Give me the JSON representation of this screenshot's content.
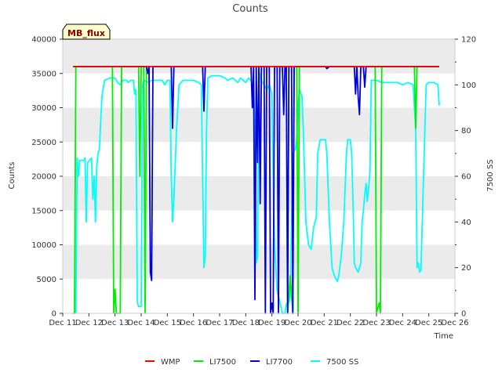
{
  "chart_data": {
    "type": "line",
    "title": "Counts",
    "xlabel": "Time",
    "ylabel": "Counts",
    "y2label": "7500 SS",
    "badge": "MB_flux",
    "x_ticks": [
      "Dec 11",
      "Dec 12",
      "Dec 13",
      "Dec 14",
      "Dec 15",
      "Dec 16",
      "Dec 17",
      "Dec 18",
      "Dec 19",
      "Dec 20",
      "Dec 21",
      "Dec 22",
      "Dec 23",
      "Dec 24",
      "Dec 25",
      "Dec 26"
    ],
    "xlim": [
      11,
      26
    ],
    "ylim": [
      0,
      40000
    ],
    "y_ticks": [
      0,
      5000,
      10000,
      15000,
      20000,
      25000,
      30000,
      35000,
      40000
    ],
    "y2lim": [
      0,
      120
    ],
    "y2_ticks": [
      0,
      20,
      40,
      60,
      80,
      100,
      120
    ],
    "grid": "horizontal bands",
    "legend_position": "bottom",
    "series": [
      {
        "name": "WMP",
        "axis": "left",
        "color": "#ff0000",
        "points": [
          [
            11.4,
            36000
          ],
          [
            25.4,
            36000
          ]
        ]
      },
      {
        "name": "LI7500",
        "axis": "left",
        "color": "#00ee00",
        "points": [
          [
            11.4,
            0
          ],
          [
            11.45,
            0
          ],
          [
            11.5,
            36000
          ],
          [
            12.9,
            36000
          ],
          [
            12.95,
            0
          ],
          [
            13.0,
            3500
          ],
          [
            13.05,
            0
          ],
          [
            13.2,
            0
          ],
          [
            13.25,
            36000
          ],
          [
            13.9,
            36000
          ],
          [
            13.95,
            20000
          ],
          [
            14.0,
            36000
          ],
          [
            14.1,
            36000
          ],
          [
            14.15,
            0
          ],
          [
            14.2,
            36000
          ],
          [
            19.55,
            36000
          ],
          [
            19.6,
            0
          ],
          [
            19.7,
            5500
          ],
          [
            19.8,
            0
          ],
          [
            19.85,
            36000
          ],
          [
            19.95,
            36000
          ],
          [
            20.0,
            0
          ],
          [
            20.05,
            36000
          ],
          [
            22.95,
            36000
          ],
          [
            23.0,
            0
          ],
          [
            23.1,
            1500
          ],
          [
            23.15,
            0
          ],
          [
            23.2,
            36000
          ],
          [
            24.45,
            36000
          ],
          [
            24.5,
            27000
          ],
          [
            24.55,
            36000
          ],
          [
            25.4,
            36000
          ]
        ]
      },
      {
        "name": "LI7700",
        "axis": "left",
        "color": "#0000dd",
        "points": [
          [
            11.4,
            36000
          ],
          [
            14.2,
            36000
          ],
          [
            14.25,
            35000
          ],
          [
            14.3,
            36000
          ],
          [
            14.35,
            6000
          ],
          [
            14.4,
            4800
          ],
          [
            14.45,
            36000
          ],
          [
            15.15,
            36000
          ],
          [
            15.2,
            27000
          ],
          [
            15.25,
            36000
          ],
          [
            16.35,
            36000
          ],
          [
            16.4,
            29500
          ],
          [
            16.45,
            36000
          ],
          [
            18.2,
            36000
          ],
          [
            18.25,
            30000
          ],
          [
            18.3,
            36000
          ],
          [
            18.35,
            2000
          ],
          [
            18.4,
            36000
          ],
          [
            18.45,
            22000
          ],
          [
            18.5,
            36000
          ],
          [
            18.55,
            16000
          ],
          [
            18.6,
            36000
          ],
          [
            18.7,
            36000
          ],
          [
            18.75,
            0
          ],
          [
            18.8,
            36000
          ],
          [
            18.9,
            36000
          ],
          [
            18.95,
            0
          ],
          [
            19.0,
            1500
          ],
          [
            19.05,
            0
          ],
          [
            19.1,
            36000
          ],
          [
            19.2,
            36000
          ],
          [
            19.25,
            0
          ],
          [
            19.3,
            36000
          ],
          [
            19.4,
            36000
          ],
          [
            19.45,
            29000
          ],
          [
            19.5,
            36000
          ],
          [
            19.55,
            36000
          ],
          [
            19.6,
            0
          ],
          [
            19.65,
            36000
          ],
          [
            19.75,
            36000
          ],
          [
            19.8,
            0
          ],
          [
            19.85,
            36000
          ],
          [
            21.05,
            36000
          ],
          [
            21.1,
            35700
          ],
          [
            21.2,
            36000
          ],
          [
            22.15,
            36000
          ],
          [
            22.2,
            32000
          ],
          [
            22.25,
            36000
          ],
          [
            22.3,
            31500
          ],
          [
            22.35,
            29000
          ],
          [
            22.4,
            36000
          ],
          [
            22.5,
            36000
          ],
          [
            22.55,
            33000
          ],
          [
            22.6,
            36000
          ],
          [
            25.4,
            36000
          ]
        ]
      },
      {
        "name": "7500 SS",
        "axis": "right",
        "color": "#00ffff",
        "points": [
          [
            11.5,
            0
          ],
          [
            11.55,
            68
          ],
          [
            11.6,
            60
          ],
          [
            11.65,
            67
          ],
          [
            11.8,
            67
          ],
          [
            11.85,
            68
          ],
          [
            11.9,
            40
          ],
          [
            11.95,
            66
          ],
          [
            12.1,
            68
          ],
          [
            12.15,
            50
          ],
          [
            12.2,
            60
          ],
          [
            12.25,
            40
          ],
          [
            12.3,
            64
          ],
          [
            12.35,
            70
          ],
          [
            12.4,
            72
          ],
          [
            12.5,
            95
          ],
          [
            12.6,
            102
          ],
          [
            12.8,
            103
          ],
          [
            12.9,
            103
          ],
          [
            13.0,
            103
          ],
          [
            13.1,
            101
          ],
          [
            13.2,
            100
          ],
          [
            13.3,
            102
          ],
          [
            13.45,
            102
          ],
          [
            13.5,
            101
          ],
          [
            13.6,
            102
          ],
          [
            13.7,
            102
          ],
          [
            13.75,
            96
          ],
          [
            13.8,
            98
          ],
          [
            13.85,
            5
          ],
          [
            13.9,
            3
          ],
          [
            14.0,
            3
          ],
          [
            14.05,
            100
          ],
          [
            14.1,
            102
          ],
          [
            14.3,
            101
          ],
          [
            14.4,
            102
          ],
          [
            14.6,
            102
          ],
          [
            14.8,
            102
          ],
          [
            14.9,
            100
          ],
          [
            15.0,
            102
          ],
          [
            15.1,
            102
          ],
          [
            15.15,
            60
          ],
          [
            15.2,
            40
          ],
          [
            15.25,
            50
          ],
          [
            15.35,
            80
          ],
          [
            15.45,
            100
          ],
          [
            15.6,
            102
          ],
          [
            15.8,
            102
          ],
          [
            16.0,
            102
          ],
          [
            16.2,
            101
          ],
          [
            16.3,
            100
          ],
          [
            16.35,
            60
          ],
          [
            16.4,
            20
          ],
          [
            16.45,
            25
          ],
          [
            16.5,
            80
          ],
          [
            16.55,
            103
          ],
          [
            16.7,
            104
          ],
          [
            16.9,
            104
          ],
          [
            17.0,
            104
          ],
          [
            17.2,
            103
          ],
          [
            17.3,
            102
          ],
          [
            17.5,
            103
          ],
          [
            17.7,
            101
          ],
          [
            17.8,
            103
          ],
          [
            18.0,
            101
          ],
          [
            18.1,
            103
          ],
          [
            18.2,
            102
          ],
          [
            18.25,
            100
          ],
          [
            18.3,
            101
          ],
          [
            18.35,
            80
          ],
          [
            18.4,
            22
          ],
          [
            18.45,
            25
          ],
          [
            18.5,
            100
          ],
          [
            18.55,
            105
          ],
          [
            18.6,
            102
          ],
          [
            18.7,
            100
          ],
          [
            18.8,
            98
          ],
          [
            18.9,
            100
          ],
          [
            19.0,
            96
          ],
          [
            19.05,
            60
          ],
          [
            19.1,
            30
          ],
          [
            19.15,
            20
          ],
          [
            19.2,
            10
          ],
          [
            19.3,
            5
          ],
          [
            19.4,
            0
          ],
          [
            19.5,
            0
          ],
          [
            19.55,
            4
          ],
          [
            19.65,
            5
          ],
          [
            19.7,
            8
          ],
          [
            19.8,
            70
          ],
          [
            19.9,
            72
          ],
          [
            19.95,
            76
          ],
          [
            20.0,
            90
          ],
          [
            20.05,
            98
          ],
          [
            20.15,
            95
          ],
          [
            20.2,
            80
          ],
          [
            20.3,
            40
          ],
          [
            20.4,
            30
          ],
          [
            20.5,
            28
          ],
          [
            20.6,
            38
          ],
          [
            20.7,
            42
          ],
          [
            20.75,
            70
          ],
          [
            20.85,
            76
          ],
          [
            21.0,
            76
          ],
          [
            21.05,
            76
          ],
          [
            21.1,
            70
          ],
          [
            21.2,
            40
          ],
          [
            21.3,
            20
          ],
          [
            21.4,
            16
          ],
          [
            21.5,
            14
          ],
          [
            21.55,
            16
          ],
          [
            21.65,
            25
          ],
          [
            21.75,
            40
          ],
          [
            21.85,
            70
          ],
          [
            21.9,
            76
          ],
          [
            22.0,
            76
          ],
          [
            22.05,
            70
          ],
          [
            22.1,
            50
          ],
          [
            22.15,
            22
          ],
          [
            22.2,
            20
          ],
          [
            22.3,
            18
          ],
          [
            22.4,
            22
          ],
          [
            22.45,
            40
          ],
          [
            22.5,
            45
          ],
          [
            22.55,
            52
          ],
          [
            22.6,
            57
          ],
          [
            22.65,
            49
          ],
          [
            22.7,
            55
          ],
          [
            22.75,
            62
          ],
          [
            22.8,
            102
          ],
          [
            22.9,
            102
          ],
          [
            23.0,
            102
          ],
          [
            23.2,
            101
          ],
          [
            23.4,
            101
          ],
          [
            23.6,
            101
          ],
          [
            23.8,
            101
          ],
          [
            24.0,
            100
          ],
          [
            24.2,
            101
          ],
          [
            24.4,
            100
          ],
          [
            24.5,
            80
          ],
          [
            24.55,
            20
          ],
          [
            24.6,
            22
          ],
          [
            24.65,
            18
          ],
          [
            24.7,
            19
          ],
          [
            24.8,
            60
          ],
          [
            24.9,
            100
          ],
          [
            25.0,
            101
          ],
          [
            25.2,
            101
          ],
          [
            25.35,
            100
          ],
          [
            25.4,
            91
          ]
        ]
      }
    ]
  }
}
